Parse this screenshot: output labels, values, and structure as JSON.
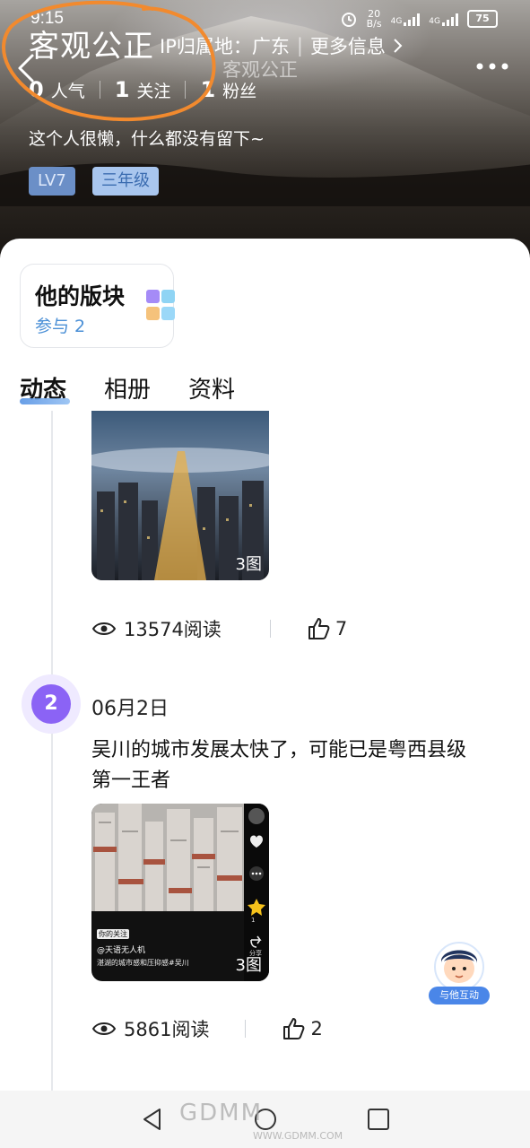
{
  "status_bar": {
    "time": "9:15",
    "net_speed_top": "20",
    "net_speed_unit": "B/s",
    "signal_1": "4G",
    "signal_2": "4G",
    "battery": "75"
  },
  "header": {
    "username": "客观公正",
    "ip_label": "IP归属地：广东",
    "more_info": "更多信息",
    "nav_title": "客观公正",
    "stats": [
      {
        "value": "0",
        "label": "人气"
      },
      {
        "value": "1",
        "label": "关注"
      },
      {
        "value": "1",
        "label": "粉丝"
      }
    ],
    "bio": "这个人很懒，什么都没有留下~",
    "badges": {
      "level": "LV7",
      "grade": "三年级"
    }
  },
  "board": {
    "title": "他的版块",
    "subtitle": "参与 2"
  },
  "tabs": [
    {
      "label": "动态",
      "active": true
    },
    {
      "label": "相册",
      "active": false
    },
    {
      "label": "资料",
      "active": false
    }
  ],
  "posts": [
    {
      "image_count": "3图",
      "views": "13574阅读",
      "likes": "7"
    },
    {
      "index": "2",
      "date": "06月2日",
      "text": "吴川的城市发展太快了，可能已是粤西县级第一王者",
      "image_count": "3图",
      "views": "5861阅读",
      "likes": "2",
      "image_overlay": {
        "tag": "你的关注",
        "author": "@天语无人机",
        "caption": "湛湖的城市感和压抑感#吴川",
        "share": "分享",
        "star_count": "1"
      }
    }
  ],
  "fab": {
    "label": "与他互动"
  },
  "watermark": {
    "text": "GDMM",
    "url": "WWW.GDMM.COM"
  },
  "colors": {
    "accent_blue": "#4a8fd6",
    "badge_purple": "#8b63f5",
    "annotation_orange": "#f28a2e"
  }
}
